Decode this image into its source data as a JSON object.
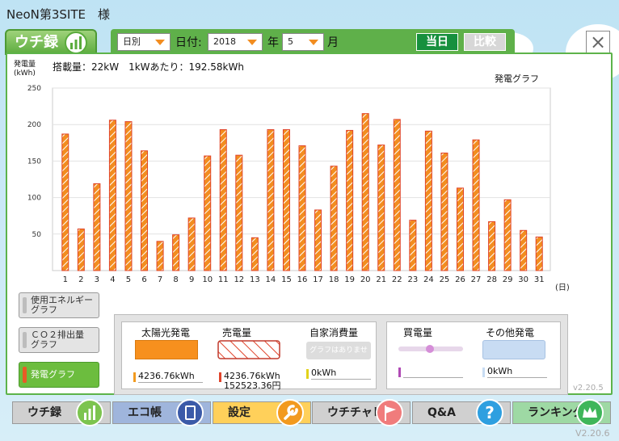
{
  "site_title": "NeoN第3SITE　様",
  "tab_label": "ウチ録",
  "toolbar": {
    "period_select": "日別",
    "date_label": "日付:",
    "year_select": "2018",
    "year_label": "年",
    "month_select": "5",
    "month_label": "月",
    "today_button": "当日",
    "compare_button": "比較"
  },
  "close_symbol": "×",
  "capacity_text": "搭載量：22kW　1kWあたり：192.58kWh",
  "y_unit": {
    "line1": "発電量",
    "line2": "(kWh)"
  },
  "chart_label": "発電グラフ",
  "chart_data": {
    "type": "bar",
    "title": "発電グラフ",
    "ylabel": "発電量 (kWh)",
    "xlabel": "(日)",
    "ylim": [
      0,
      250
    ],
    "yticks": [
      50,
      100,
      150,
      200,
      250
    ],
    "categories": [
      "1",
      "2",
      "3",
      "4",
      "5",
      "6",
      "7",
      "8",
      "9",
      "10",
      "11",
      "12",
      "13",
      "14",
      "15",
      "16",
      "17",
      "18",
      "19",
      "20",
      "21",
      "22",
      "23",
      "24",
      "25",
      "26",
      "27",
      "28",
      "29",
      "30",
      "31"
    ],
    "values": [
      187,
      57,
      119,
      206,
      204,
      164,
      40,
      49,
      72,
      157,
      193,
      158,
      45,
      193,
      193,
      171,
      83,
      143,
      192,
      215,
      172,
      207,
      69,
      191,
      161,
      113,
      179,
      67,
      97,
      55,
      46
    ],
    "bar_color": "#f28d20",
    "bar_stroke": "#e0442b"
  },
  "side_buttons": [
    {
      "label": "使用エネルギーグラフ",
      "line1": "使用エネルギー",
      "line2": "グラフ"
    },
    {
      "label": "ＣＯ２排出量グラフ",
      "line1": "ＣＯ２排出量",
      "line2": "グラフ"
    },
    {
      "label": "発電グラフ"
    }
  ],
  "summary": {
    "solar_label": "太陽光発電",
    "solar_value": "4236.76kWh",
    "sell_label": "売電量",
    "sell_value": "4236.76kWh",
    "sell_yen": "152523.36円",
    "self_label": "自家消費量",
    "self_graph_note": "グラフはありません",
    "self_value": "0kWh",
    "buy_label": "買電量",
    "other_label": "その他発電",
    "other_value": "0kWh"
  },
  "version_inner": "v2.20.5",
  "version_outer": "V2.20.6",
  "nav": [
    {
      "label": "ウチ録",
      "color": "#d0d0d0",
      "icon": "bar-chart-icon",
      "icon_color": "#7cc44f"
    },
    {
      "label": "エコ帳",
      "color": "#9fb5dc",
      "icon": "notebook-icon",
      "icon_color": "#3b5aa8"
    },
    {
      "label": "設定",
      "color": "#ffd05a",
      "icon": "wrench-icon",
      "icon_color": "#f29a1f"
    },
    {
      "label": "ウチチャレ",
      "color": "#d0d0d0",
      "icon": "flag-icon",
      "icon_color": "#f07c7c"
    },
    {
      "label": "Q&A",
      "color": "#d0d0d0",
      "icon": "question-icon",
      "icon_color": "#2e9fe0"
    },
    {
      "label": "ランキング",
      "color": "#9ed9a4",
      "icon": "crown-icon",
      "icon_color": "#3fb65a"
    }
  ]
}
